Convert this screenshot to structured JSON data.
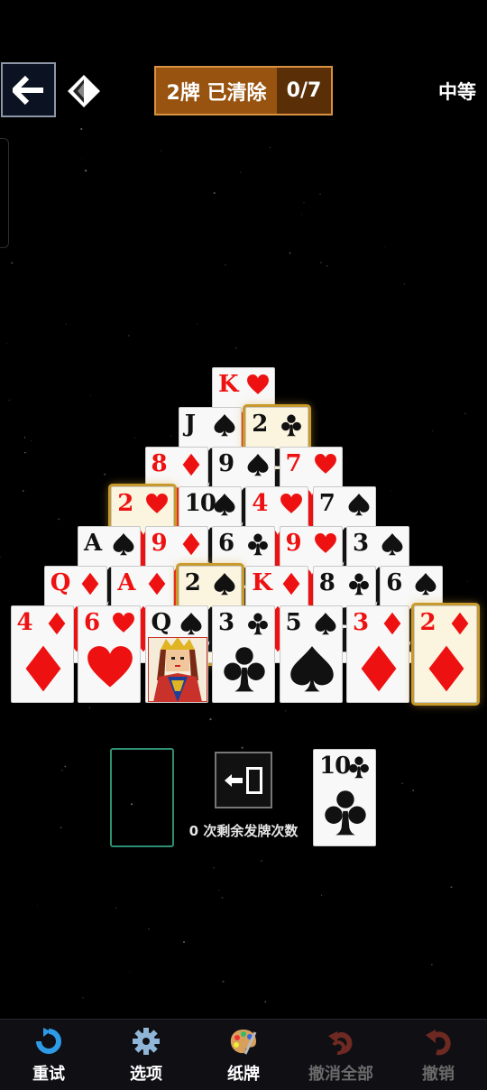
{
  "header": {
    "progress_label": "2牌 已清除",
    "progress_count": "0/7",
    "difficulty": "中等",
    "back_icon": "arrow-left-icon",
    "logo_icon": "diamond-logo-icon"
  },
  "pyramid": {
    "rows": [
      [
        {
          "rank": "K",
          "suit": "hearts"
        }
      ],
      [
        {
          "rank": "J",
          "suit": "spades"
        },
        {
          "rank": "2",
          "suit": "clubs",
          "highlight": true
        }
      ],
      [
        {
          "rank": "8",
          "suit": "diamonds"
        },
        {
          "rank": "9",
          "suit": "spades"
        },
        {
          "rank": "7",
          "suit": "hearts"
        }
      ],
      [
        {
          "rank": "2",
          "suit": "hearts",
          "highlight": true
        },
        {
          "rank": "10",
          "suit": "spades"
        },
        {
          "rank": "4",
          "suit": "hearts"
        },
        {
          "rank": "7",
          "suit": "spades"
        }
      ],
      [
        {
          "rank": "A",
          "suit": "spades"
        },
        {
          "rank": "9",
          "suit": "diamonds"
        },
        {
          "rank": "6",
          "suit": "clubs"
        },
        {
          "rank": "9",
          "suit": "hearts"
        },
        {
          "rank": "3",
          "suit": "spades"
        }
      ],
      [
        {
          "rank": "Q",
          "suit": "diamonds"
        },
        {
          "rank": "A",
          "suit": "diamonds"
        },
        {
          "rank": "2",
          "suit": "spades",
          "highlight": true
        },
        {
          "rank": "K",
          "suit": "diamonds"
        },
        {
          "rank": "8",
          "suit": "clubs"
        },
        {
          "rank": "6",
          "suit": "spades"
        }
      ],
      [
        {
          "rank": "4",
          "suit": "diamonds"
        },
        {
          "rank": "6",
          "suit": "hearts"
        },
        {
          "rank": "Q",
          "suit": "spades",
          "face": true
        },
        {
          "rank": "3",
          "suit": "clubs"
        },
        {
          "rank": "5",
          "suit": "spades"
        },
        {
          "rank": "3",
          "suit": "diamonds"
        },
        {
          "rank": "2",
          "suit": "diamonds",
          "highlight": true
        }
      ]
    ]
  },
  "stock": {
    "redeals_text": "0 次剩余发牌次数",
    "waste_card": {
      "rank": "10",
      "suit": "clubs"
    }
  },
  "bottom_nav": [
    {
      "label": "重试",
      "icon": "restart-icon",
      "disabled": false
    },
    {
      "label": "选项",
      "icon": "gear-icon",
      "disabled": false
    },
    {
      "label": "纸牌",
      "icon": "palette-icon",
      "disabled": false
    },
    {
      "label": "撤消全部",
      "icon": "undo-all-icon",
      "disabled": true
    },
    {
      "label": "撤销",
      "icon": "undo-icon",
      "disabled": true
    }
  ],
  "colors": {
    "red_suit": "#ee1111",
    "black_suit": "#111111",
    "highlight": "#c89a2c",
    "progress_bg": "#97530f"
  }
}
